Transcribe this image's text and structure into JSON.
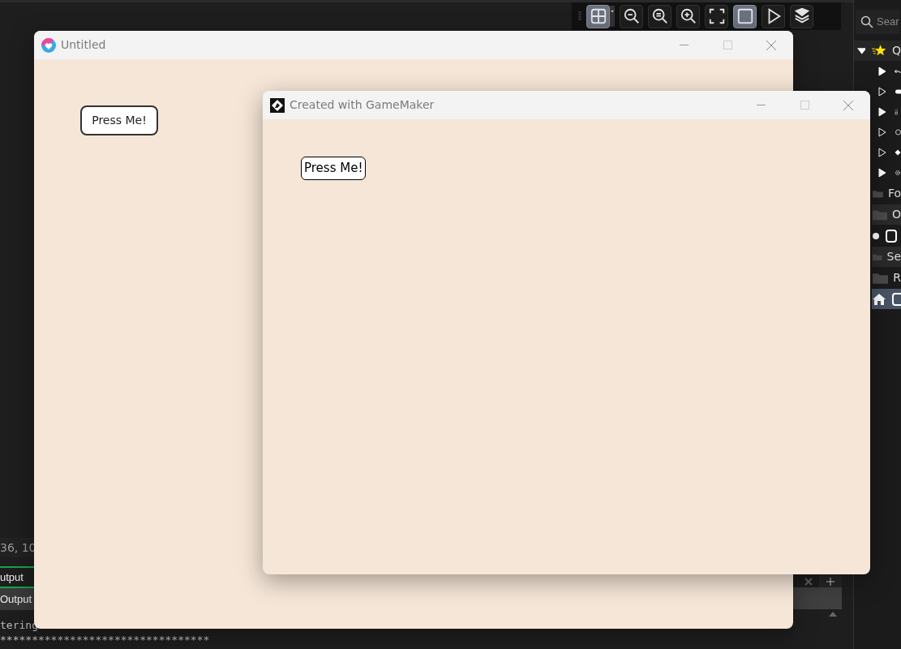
{
  "toolbar": [
    {
      "kind": "grid",
      "selected": true
    },
    {
      "kind": "zoom-out",
      "selected": false
    },
    {
      "kind": "zoom-reset",
      "selected": false
    },
    {
      "kind": "zoom-in",
      "selected": false
    },
    {
      "kind": "fit",
      "selected": false
    },
    {
      "kind": "frame",
      "selected": true
    },
    {
      "kind": "play",
      "selected": false
    },
    {
      "kind": "layers",
      "selected": false
    }
  ],
  "asset_panel": {
    "search": {
      "placeholder": "Sear"
    },
    "tree": [
      {
        "label": "Q",
        "kind": "favorites",
        "expanded": true,
        "children": [
          {
            "kind": "undo",
            "filled": true
          },
          {
            "kind": "pill",
            "filled": false
          },
          {
            "kind": "tiles",
            "filled": true
          },
          {
            "kind": "ring",
            "filled": false
          },
          {
            "kind": "diamond",
            "filled": false
          },
          {
            "kind": "gear",
            "filled": true
          }
        ]
      },
      {
        "label": "Fo",
        "kind": "folder",
        "selected": false
      },
      {
        "label": "O",
        "kind": "folder",
        "selected": false
      },
      {
        "kind": "object",
        "selected": false
      },
      {
        "label": "Se",
        "kind": "folder",
        "selected": false
      },
      {
        "label": "R",
        "kind": "folder",
        "selected": false
      },
      {
        "kind": "room",
        "selected": true
      }
    ]
  },
  "status": {
    "coords": "36, 10"
  },
  "output": {
    "tabs": [
      {
        "label": "utput",
        "selected": true
      },
      {
        "label": "Output",
        "selected": false
      }
    ],
    "lines": [
      "tering",
      "*********************************"
    ]
  },
  "windows": [
    {
      "title": "Untitled",
      "button": "Press Me!"
    },
    {
      "title": "Created with GameMaker",
      "button": "Press Me!"
    }
  ]
}
